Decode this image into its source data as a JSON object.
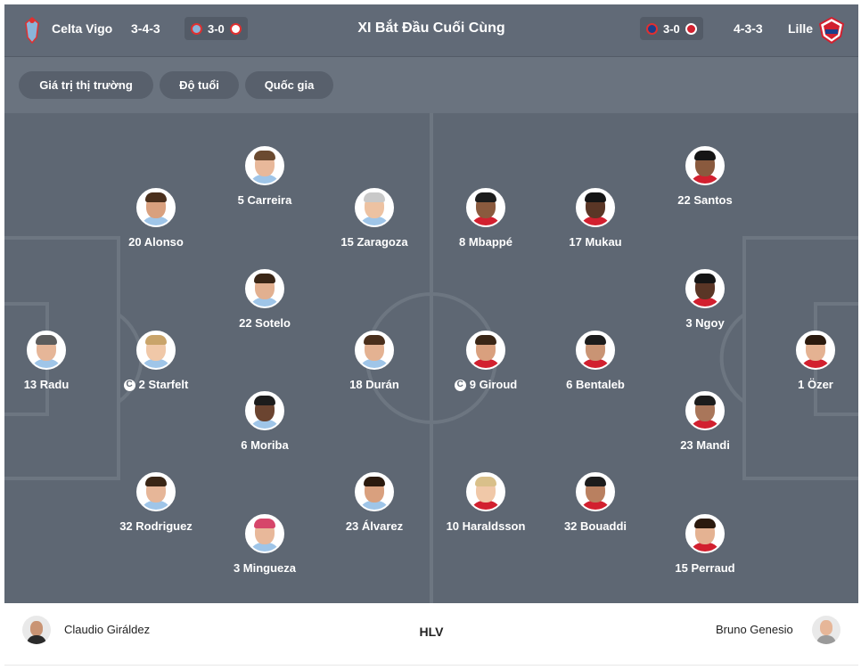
{
  "header": {
    "title": "XI Bắt Đầu Cuối Cùng",
    "home": {
      "name": "Celta Vigo",
      "formation": "3-4-3",
      "last_score": "3-0",
      "crest_color": "#8ab4d9",
      "opp_crest_color": "#e03030"
    },
    "away": {
      "name": "Lille",
      "formation": "4-3-3",
      "last_score": "3-0",
      "crest_color": "#d2202f",
      "opp_crest_color": "#1b3f8b"
    }
  },
  "filters": [
    "Giá trị thị trường",
    "Độ tuổi",
    "Quốc gia"
  ],
  "home_players": [
    {
      "label": "5 Carreira",
      "captain": false,
      "skin": "#e8b89a",
      "hair": "#6b4a30",
      "shirt": "#9fc5e8"
    },
    {
      "label": "20 Alonso",
      "captain": false,
      "skin": "#d9a07e",
      "hair": "#4a2f1c",
      "shirt": "#9fc5e8"
    },
    {
      "label": "15 Zaragoza",
      "captain": false,
      "skin": "#edc2a2",
      "hair": "#c9c9c9",
      "shirt": "#9fc5e8"
    },
    {
      "label": "22 Sotelo",
      "captain": false,
      "skin": "#e2b090",
      "hair": "#3a2616",
      "shirt": "#9fc5e8"
    },
    {
      "label": "13 Radu",
      "captain": false,
      "skin": "#e6b698",
      "hair": "#5c5c5c",
      "shirt": "#9fc5e8"
    },
    {
      "label": "2 Starfelt",
      "captain": true,
      "skin": "#f0c8a8",
      "hair": "#c9a46a",
      "shirt": "#9fc5e8"
    },
    {
      "label": "18 Durán",
      "captain": false,
      "skin": "#e4b292",
      "hair": "#4a2f1c",
      "shirt": "#9fc5e8"
    },
    {
      "label": "6 Moriba",
      "captain": false,
      "skin": "#6b4430",
      "hair": "#1c1c1c",
      "shirt": "#9fc5e8"
    },
    {
      "label": "32 Rodriguez",
      "captain": false,
      "skin": "#e6b698",
      "hair": "#3a2616",
      "shirt": "#9fc5e8"
    },
    {
      "label": "23 Álvarez",
      "captain": false,
      "skin": "#d9a07e",
      "hair": "#2b1a0e",
      "shirt": "#9fc5e8"
    },
    {
      "label": "3 Mingueza",
      "captain": false,
      "skin": "#e8b89a",
      "hair": "#d6466a",
      "shirt": "#9fc5e8"
    }
  ],
  "away_players": [
    {
      "label": "8 Mbappé",
      "captain": false,
      "skin": "#8a5a3e",
      "hair": "#1c1c1c",
      "shirt": "#d2202f"
    },
    {
      "label": "17 Mukau",
      "captain": false,
      "skin": "#5a3626",
      "hair": "#151515",
      "shirt": "#d2202f"
    },
    {
      "label": "22 Santos",
      "captain": false,
      "skin": "#8a5a3e",
      "hair": "#151515",
      "shirt": "#d2202f"
    },
    {
      "label": "3 Ngoy",
      "captain": false,
      "skin": "#5a3626",
      "hair": "#151515",
      "shirt": "#d2202f"
    },
    {
      "label": "9 Giroud",
      "captain": true,
      "skin": "#d9a07e",
      "hair": "#3a2616",
      "shirt": "#d2202f"
    },
    {
      "label": "6 Bentaleb",
      "captain": false,
      "skin": "#c99474",
      "hair": "#1c1c1c",
      "shirt": "#d2202f"
    },
    {
      "label": "1 Özer",
      "captain": false,
      "skin": "#e4b292",
      "hair": "#2b1a0e",
      "shirt": "#d2202f"
    },
    {
      "label": "23 Mandi",
      "captain": false,
      "skin": "#a9765a",
      "hair": "#1c1c1c",
      "shirt": "#d2202f"
    },
    {
      "label": "10 Haraldsson",
      "captain": false,
      "skin": "#f0c8a8",
      "hair": "#d9c08a",
      "shirt": "#d2202f"
    },
    {
      "label": "32 Bouaddi",
      "captain": false,
      "skin": "#b98060",
      "hair": "#1c1c1c",
      "shirt": "#d2202f"
    },
    {
      "label": "15 Perraud",
      "captain": false,
      "skin": "#e4b292",
      "hair": "#2b1a0e",
      "shirt": "#d2202f"
    }
  ],
  "coaches": {
    "label": "HLV",
    "home": "Claudio Giráldez",
    "away": "Bruno Genesio"
  },
  "captain_mark": "C"
}
